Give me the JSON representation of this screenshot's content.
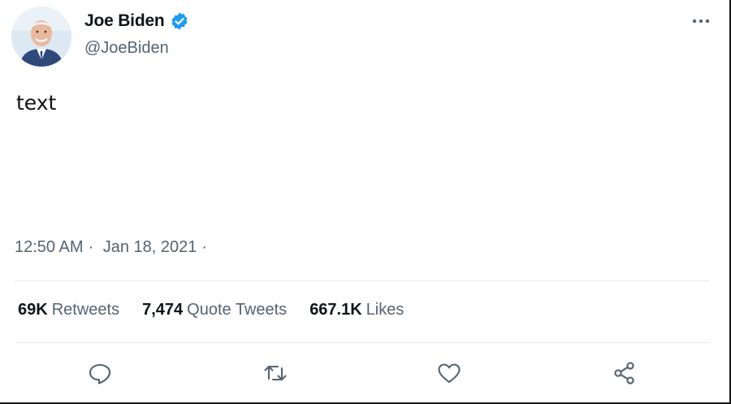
{
  "author": {
    "display_name": "Joe Biden",
    "handle": "@JoeBiden",
    "verified": true,
    "avatar_icon": "profile-photo"
  },
  "tweet": {
    "text": "text",
    "time": "12:50 AM",
    "date": "Jan 18, 2021",
    "separator": "·"
  },
  "stats": {
    "retweets": {
      "count": "69K",
      "label": "Retweets"
    },
    "quotes": {
      "count": "7,474",
      "label": "Quote Tweets"
    },
    "likes": {
      "count": "667.1K",
      "label": "Likes"
    }
  },
  "actions": [
    {
      "name": "reply",
      "icon": "reply-icon"
    },
    {
      "name": "retweet",
      "icon": "retweet-icon"
    },
    {
      "name": "like",
      "icon": "heart-icon"
    },
    {
      "name": "share",
      "icon": "share-icon"
    }
  ],
  "colors": {
    "verified_blue": "#1d9bf0",
    "secondary_text": "#536471",
    "primary_text": "#0f1419"
  }
}
